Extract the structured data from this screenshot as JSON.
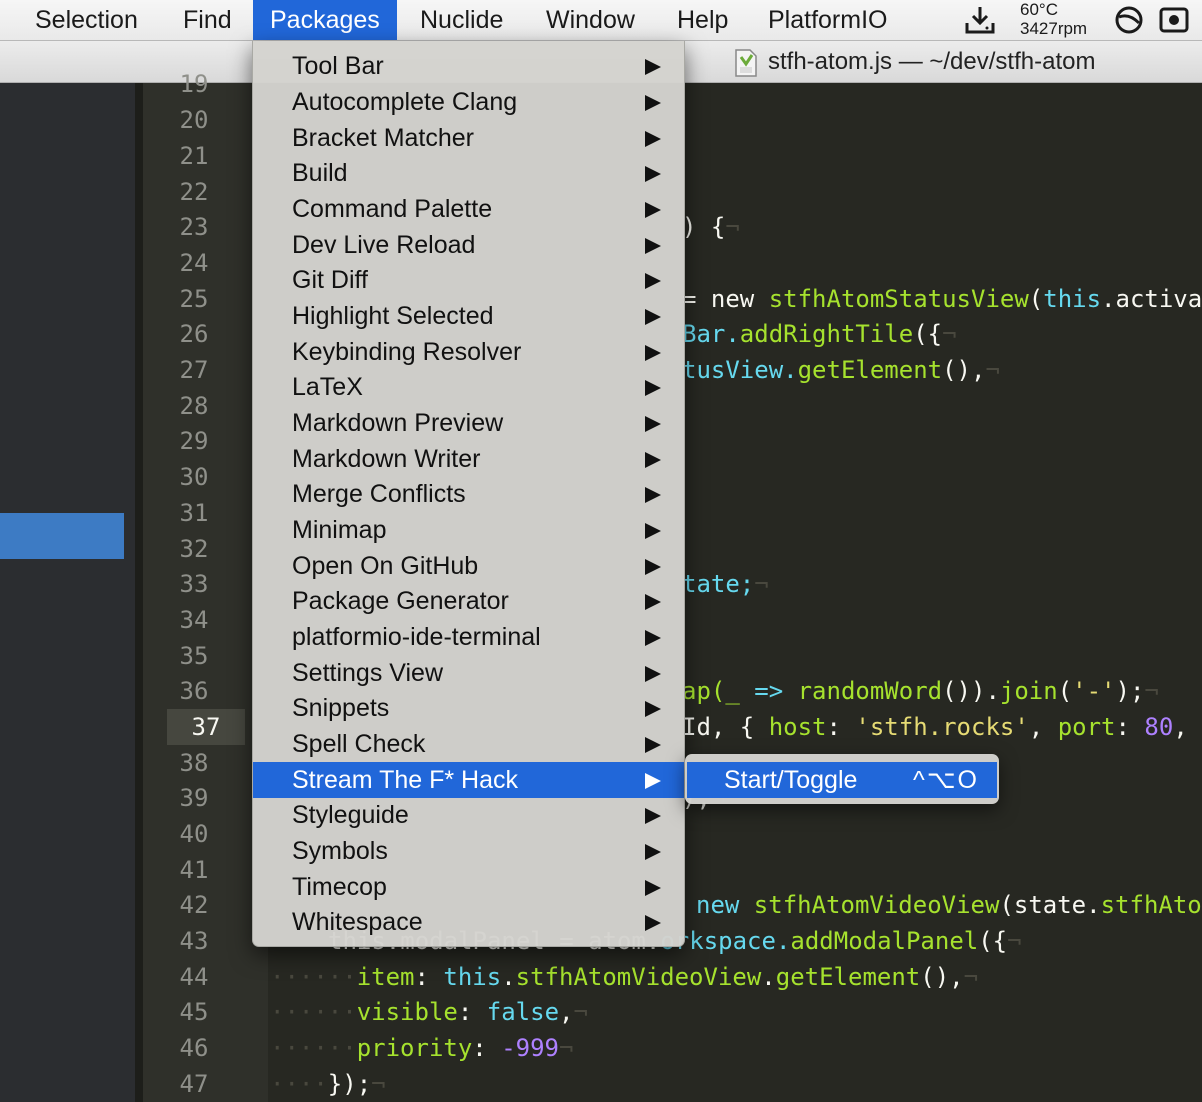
{
  "menubar": {
    "items": [
      "Selection",
      "Find",
      "Packages",
      "Nuclide",
      "Window",
      "Help",
      "PlatformIO"
    ],
    "active": "Packages",
    "temperature": "60°C",
    "fan_speed": "3427rpm",
    "icons": [
      "download-icon",
      "fan-icon",
      "record-icon"
    ]
  },
  "window": {
    "title": "stfh-atom.js — ~/dev/stfh-atom"
  },
  "gutter": {
    "line_numbers": [
      "19",
      "20",
      "21",
      "22",
      "23",
      "24",
      "25",
      "26",
      "27",
      "28",
      "29",
      "30",
      "31",
      "32",
      "33",
      "34",
      "35",
      "36",
      "37",
      "38",
      "39",
      "40",
      "41",
      "42",
      "43",
      "44",
      "45",
      "46",
      "47"
    ],
    "current_line": "37"
  },
  "code": {
    "l23": ") {",
    "l25a": "= new ",
    "l25b": "stfhAtomStatusView",
    "l25c": "(",
    "l25d": "this",
    "l25e": ".activa",
    "l26a": "Bar.",
    "l26b": "addRightTile",
    "l26c": "({",
    "l27a": "tusView.",
    "l27b": "getElement",
    "l27c": "(),",
    "l33": "tate;",
    "l36a": "ap(_ ",
    "l36b": "=>",
    "l36c": " randomWord",
    "l36d": "()).",
    "l36e": "join",
    "l36f": "(",
    "l36g": "'-'",
    "l36h": ");",
    "l37a": "Id, { ",
    "l37b": "host",
    "l37c": ": ",
    "l37d": "'stfh.rocks'",
    "l37e": ", ",
    "l37f": "port",
    "l37g": ": ",
    "l37h": "80",
    "l37i": ",",
    "l39": ");",
    "l42a": "new ",
    "l42b": "stfhAtomVideoView",
    "l42c": "(state.",
    "l42d": "stfhAto",
    "l43a": "this.modalPanel = atom.",
    "l43b": "orkspace.",
    "l43c": "addModalPanel",
    "l43d": "({",
    "l44a": "item",
    "l44b": ": ",
    "l44c": "this",
    "l44d": ".",
    "l44e": "stfhAtomVideoView",
    "l44f": ".",
    "l44g": "getElement",
    "l44h": "(),",
    "l45a": "visible",
    "l45b": ": ",
    "l45c": "false",
    "l45d": ",",
    "l46a": "priority",
    "l46b": ": ",
    "l46c": "-999",
    "l47": "});",
    "eol": "¬",
    "indent4": "····",
    "indent6": "······"
  },
  "packages_menu": {
    "items": [
      "Tool Bar",
      "Autocomplete Clang",
      "Bracket Matcher",
      "Build",
      "Command Palette",
      "Dev Live Reload",
      "Git Diff",
      "Highlight Selected",
      "Keybinding Resolver",
      "LaTeX",
      "Markdown Preview",
      "Markdown Writer",
      "Merge Conflicts",
      "Minimap",
      "Open On GitHub",
      "Package Generator",
      "platformio-ide-terminal",
      "Settings View",
      "Snippets",
      "Spell Check",
      "Stream The F* Hack",
      "Styleguide",
      "Symbols",
      "Timecop",
      "Whitespace"
    ],
    "selected": "Stream The F* Hack"
  },
  "submenu": {
    "label": "Start/Toggle",
    "shortcut": "^⌥O"
  },
  "colors": {
    "menu_highlight": "#2167d9",
    "editor_bg": "#272822",
    "gutter_bg": "#2f302a"
  }
}
